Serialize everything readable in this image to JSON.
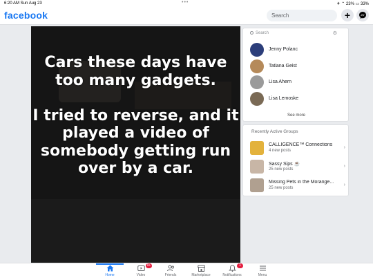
{
  "statusbar": {
    "time": "6:20 AM   Sun Aug 23",
    "dots": "•••",
    "right": "✈ ⌃ 23% ▭ 33%"
  },
  "header": {
    "logo": "facebook",
    "search_placeholder": "Search",
    "plus": "+"
  },
  "post": {
    "text": "Cars these days have too many gadgets.\n\nI tried to reverse, and it played a video of somebody getting run over by a car."
  },
  "contacts": {
    "search_placeholder": "Search",
    "items": [
      {
        "name": "Jenny Polanc",
        "color": "#2c3e7a"
      },
      {
        "name": "Tatiana Geist",
        "color": "#b58a5a"
      },
      {
        "name": "Lisa Ahern",
        "color": "#9a9a9a"
      },
      {
        "name": "Lisa Lemoske",
        "color": "#7a6a55"
      }
    ],
    "see_more": "See more"
  },
  "groups": {
    "title": "Recently Active Groups",
    "items": [
      {
        "name": "CALLIGENCE™ Connections",
        "sub": "4 new posts",
        "color": "#e3b23c"
      },
      {
        "name": "Sassy Sips ☕",
        "sub": "25 new posts",
        "color": "#c8b6a6"
      },
      {
        "name": "Missing Pets in the Morange...",
        "sub": "25 new posts",
        "color": "#b0a090"
      }
    ]
  },
  "nav": [
    {
      "label": "Home",
      "icon": "home-icon",
      "badge": ""
    },
    {
      "label": "Video",
      "icon": "video-icon",
      "badge": "9+"
    },
    {
      "label": "Friends",
      "icon": "friends-icon",
      "badge": ""
    },
    {
      "label": "Marketplace",
      "icon": "marketplace-icon",
      "badge": ""
    },
    {
      "label": "Notifications",
      "icon": "bell-icon",
      "badge": "1"
    },
    {
      "label": "Menu",
      "icon": "menu-icon",
      "badge": ""
    }
  ],
  "colors": {
    "brand": "#1877f2",
    "badge": "#e41e3f"
  }
}
